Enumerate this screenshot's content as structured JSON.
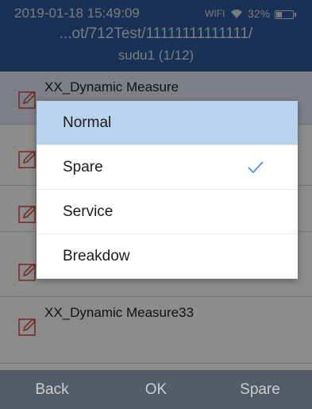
{
  "status": {
    "time": "2019-01-18 15:49:09",
    "wifi": "WIFI",
    "battery": "32%",
    "battery_level": 0.32
  },
  "header": {
    "path": "...ot/712Test/11111111111111/",
    "file": "sudu1 (1/12)"
  },
  "list": {
    "items": [
      {
        "label": "XX_Dynamic Measure",
        "icon": "edit-icon"
      },
      {
        "label": "",
        "icon": "edit-icon"
      },
      {
        "label": "",
        "icon": "edit-icon"
      },
      {
        "label": "",
        "icon": "edit-icon"
      },
      {
        "label": "XX_Dynamic Measure33",
        "icon": "edit-icon"
      }
    ]
  },
  "popup": {
    "options": [
      {
        "label": "Normal",
        "highlighted": true
      },
      {
        "label": "Spare",
        "checked": true
      },
      {
        "label": "Service"
      },
      {
        "label": "Breakdow"
      }
    ]
  },
  "footer": {
    "back": "Back",
    "ok": "OK",
    "spare": "Spare"
  },
  "colors": {
    "header_bg": "#2e5a9a",
    "highlight": "#b9d3ec",
    "check": "#4a90d9",
    "footer_bg": "#545b66",
    "edit_icon": "#d9534f"
  }
}
